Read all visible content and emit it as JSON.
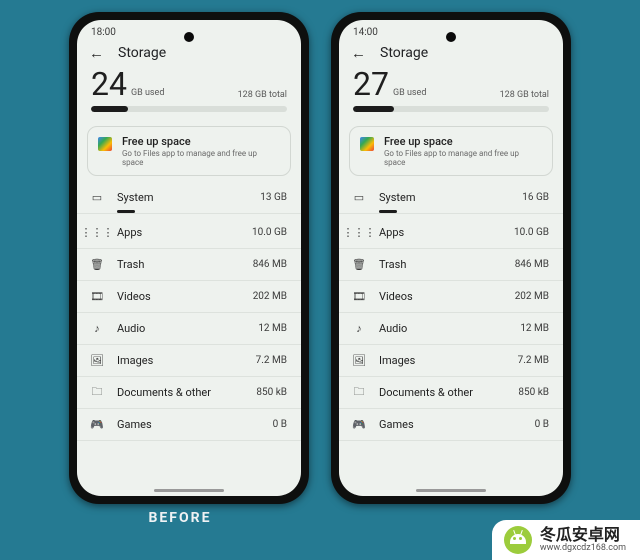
{
  "page_bg": "#257a92",
  "before_label": "BEFORE",
  "phones": [
    {
      "time": "18:00",
      "title": "Storage",
      "used_num": "24",
      "used_unit": "GB used",
      "total": "128 GB total",
      "fill_pct": 19,
      "card": {
        "title": "Free up space",
        "sub": "Go to Files app to manage and free up space"
      },
      "rows": [
        {
          "icon": "phone-icon",
          "glyph": "▭",
          "label": "System",
          "val": "13 GB",
          "under": true
        },
        {
          "icon": "apps-icon",
          "glyph": "⋮⋮⋮",
          "label": "Apps",
          "val": "10.0 GB"
        },
        {
          "icon": "trash-icon",
          "glyph": "🗑",
          "label": "Trash",
          "val": "846 MB"
        },
        {
          "icon": "videos-icon",
          "glyph": "🎞",
          "label": "Videos",
          "val": "202 MB"
        },
        {
          "icon": "audio-icon",
          "glyph": "♪",
          "label": "Audio",
          "val": "12 MB"
        },
        {
          "icon": "images-icon",
          "glyph": "🖼",
          "label": "Images",
          "val": "7.2 MB"
        },
        {
          "icon": "docs-icon",
          "glyph": "🗀",
          "label": "Documents & other",
          "val": "850 kB"
        },
        {
          "icon": "games-icon",
          "glyph": "🎮",
          "label": "Games",
          "val": "0 B"
        }
      ]
    },
    {
      "time": "14:00",
      "title": "Storage",
      "used_num": "27",
      "used_unit": "GB used",
      "total": "128 GB total",
      "fill_pct": 21,
      "card": {
        "title": "Free up space",
        "sub": "Go to Files app to manage and free up space"
      },
      "rows": [
        {
          "icon": "phone-icon",
          "glyph": "▭",
          "label": "System",
          "val": "16 GB",
          "under": true
        },
        {
          "icon": "apps-icon",
          "glyph": "⋮⋮⋮",
          "label": "Apps",
          "val": "10.0 GB"
        },
        {
          "icon": "trash-icon",
          "glyph": "🗑",
          "label": "Trash",
          "val": "846 MB"
        },
        {
          "icon": "videos-icon",
          "glyph": "🎞",
          "label": "Videos",
          "val": "202 MB"
        },
        {
          "icon": "audio-icon",
          "glyph": "♪",
          "label": "Audio",
          "val": "12 MB"
        },
        {
          "icon": "images-icon",
          "glyph": "🖼",
          "label": "Images",
          "val": "7.2 MB"
        },
        {
          "icon": "docs-icon",
          "glyph": "🗀",
          "label": "Documents & other",
          "val": "850 kB"
        },
        {
          "icon": "games-icon",
          "glyph": "🎮",
          "label": "Games",
          "val": "0 B"
        }
      ]
    }
  ],
  "footer": {
    "brand_cn": "冬瓜安卓网",
    "url": "www.dgxcdz168.com"
  }
}
